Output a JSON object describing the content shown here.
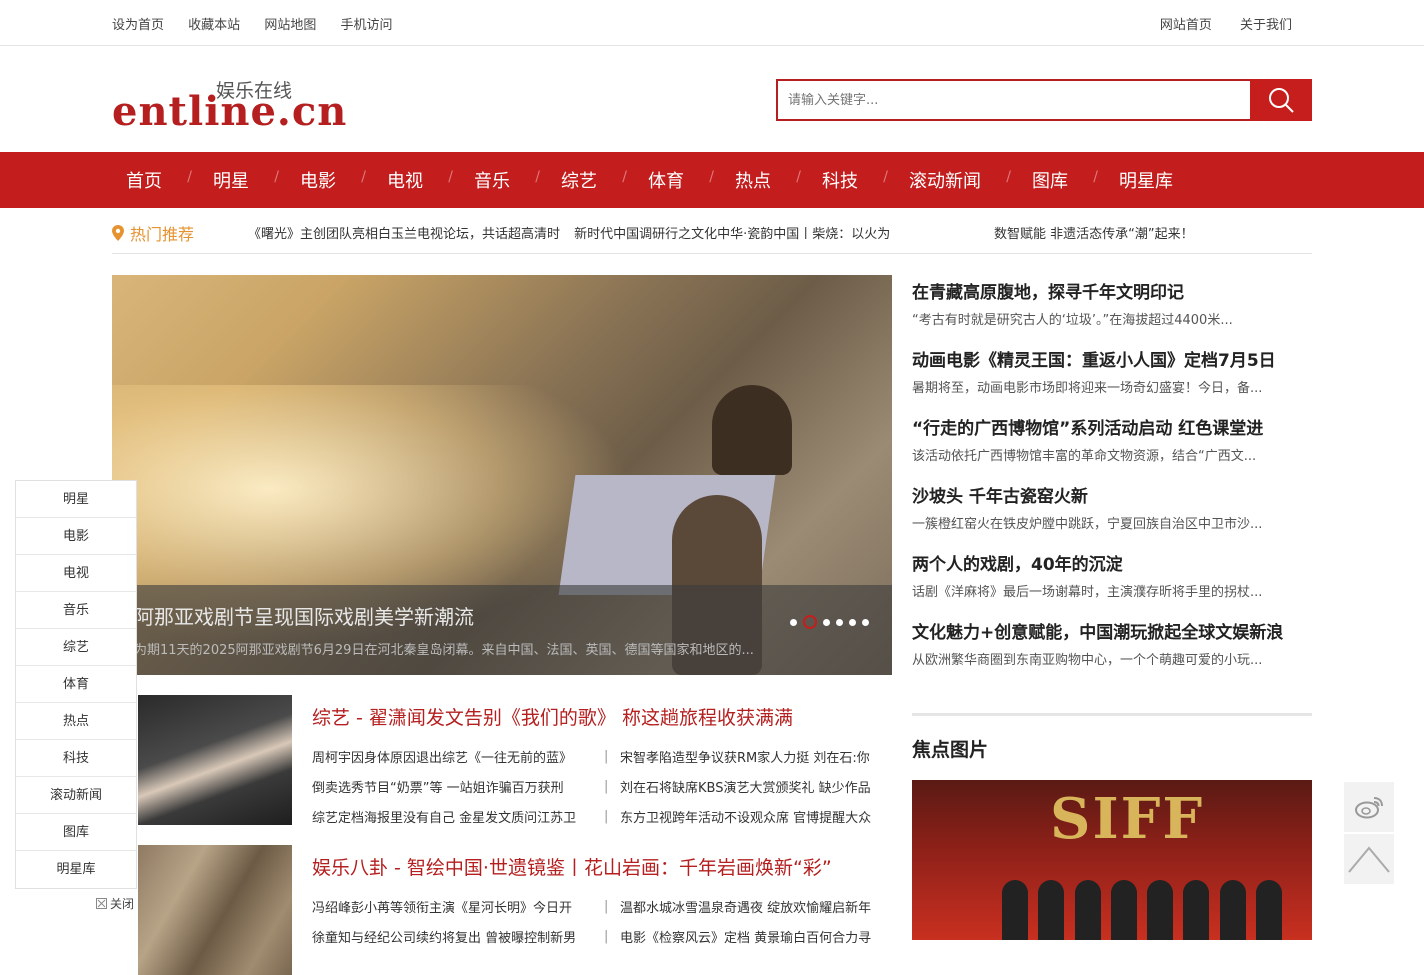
{
  "topbar": {
    "left": [
      "设为首页",
      "收藏本站",
      "网站地图",
      "手机访问"
    ],
    "right": [
      "网站首页",
      "关于我们"
    ]
  },
  "logo": {
    "main": "entline.cn",
    "sub": "娱乐在线"
  },
  "search": {
    "placeholder": "请输入关键字..."
  },
  "nav": [
    "首页",
    "明星",
    "电影",
    "电视",
    "音乐",
    "综艺",
    "体育",
    "热点",
    "科技",
    "滚动新闻",
    "图库",
    "明星库"
  ],
  "hot": {
    "label": "热门推荐",
    "items": [
      "《曙光》主创团队亮相白玉兰电视论坛，共话超高清时",
      "新时代中国调研行之文化中华·瓷韵中国丨柴烧：以火为",
      "数智赋能 非遗活态传承“潮”起来！"
    ]
  },
  "slider": {
    "title": "阿那亚戏剧节呈现国际戏剧美学新潮流",
    "desc": "为期11天的2025阿那亚戏剧节6月29日在河北秦皇岛闭幕。来自中国、法国、英国、德国等国家和地区的...",
    "active_slide": 1,
    "slide_count": 6
  },
  "right_list": [
    {
      "title": "在青藏高原腹地，探寻千年文明印记",
      "desc": "“考古有时就是研究古人的‘垃圾’。”在海拔超过4400米..."
    },
    {
      "title": "动画电影《精灵王国：重返小人国》定档7月5日",
      "desc": "暑期将至，动画电影市场即将迎来一场奇幻盛宴！今日，备..."
    },
    {
      "title": "“行走的广西博物馆”系列活动启动 红色课堂进",
      "desc": "该活动依托广西博物馆丰富的革命文物资源，结合“广西文..."
    },
    {
      "title": "沙坡头 千年古瓷窑火新",
      "desc": "一簇橙红窑火在铁皮炉膛中跳跃，宁夏回族自治区中卫市沙..."
    },
    {
      "title": "两个人的戏剧，40年的沉淀",
      "desc": "话剧《洋麻将》最后一场谢幕时，主演濮存昕将手里的拐杖..."
    },
    {
      "title": "文化魅力+创意赋能，中国潮玩掀起全球文娱新浪",
      "desc": "从欧洲繁华商圈到东南亚购物中心，一个个萌趣可爱的小玩..."
    }
  ],
  "focus": {
    "heading": "焦点图片",
    "sign": "SIFF"
  },
  "news": [
    {
      "title": "综艺 - 翟潇闻发文告别《我们的歌》 称这趟旅程收获满满",
      "rows": [
        [
          "周柯宇因身体原因退出综艺《一往无前的蓝》",
          "宋智孝陷造型争议获RM家人力挺 刘在石:你"
        ],
        [
          "倒卖选秀节目“奶票”等 一站姐诈骗百万获刑",
          "刘在石将缺席KBS演艺大赏颁奖礼 缺少作品"
        ],
        [
          "综艺定档海报里没有自己 金星发文质问江苏卫",
          "东方卫视跨年活动不设观众席 官博提醒大众"
        ]
      ]
    },
    {
      "title": "娱乐八卦 - 智绘中国·世遗镜鉴丨花山岩画：千年岩画焕新“彩”",
      "rows": [
        [
          "冯绍峰彭小苒等领衔主演《星河长明》今日开",
          "温都水城冰雪温泉奇遇夜 绽放欢愉耀启新年"
        ],
        [
          "徐童知与经纪公司续约将复出 曾被曝控制新男",
          "电影《检察风云》定档 黄景瑜白百何合力寻"
        ]
      ]
    }
  ],
  "sidemenu": [
    "明星",
    "电影",
    "电视",
    "音乐",
    "综艺",
    "体育",
    "热点",
    "科技",
    "滚动新闻",
    "图库",
    "明星库"
  ],
  "sideclose": "关闭",
  "colors": {
    "brand": "#c31d1d",
    "hot": "#e5922f"
  }
}
